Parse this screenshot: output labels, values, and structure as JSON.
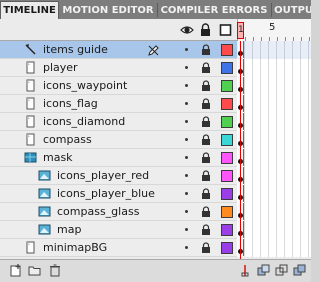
{
  "tabs": [
    {
      "label": "TIMELINE",
      "active": true
    },
    {
      "label": "MOTION EDITOR",
      "active": false
    },
    {
      "label": "COMPILER ERRORS",
      "active": false
    },
    {
      "label": "OUTPUT",
      "active": false
    }
  ],
  "header": {
    "icons": [
      "eye-icon",
      "lock-icon",
      "outline-icon"
    ],
    "ruler_numbers": [
      "1",
      "5"
    ],
    "playhead_frame": "1"
  },
  "layers": [
    {
      "name": "items guide",
      "type": "guide",
      "color": "#ff4b4b",
      "selected": true,
      "pencil": true
    },
    {
      "name": "player",
      "type": "normal",
      "color": "#3f73e8"
    },
    {
      "name": "icons_waypoint",
      "type": "normal",
      "color": "#4fd14f"
    },
    {
      "name": "icons_flag",
      "type": "normal",
      "color": "#ff4b4b"
    },
    {
      "name": "icons_diamond",
      "type": "normal",
      "color": "#4fd14f"
    },
    {
      "name": "compass",
      "type": "normal",
      "color": "#3bd6d6"
    },
    {
      "name": "mask",
      "type": "mask",
      "color": "#ff55ff"
    },
    {
      "name": "icons_player_red",
      "type": "masked",
      "color": "#ff55ff"
    },
    {
      "name": "icons_player_blue",
      "type": "masked",
      "color": "#9a3ee8"
    },
    {
      "name": "compass_glass",
      "type": "masked",
      "color": "#ff8a1e"
    },
    {
      "name": "map",
      "type": "masked",
      "color": "#9a3ee8"
    },
    {
      "name": "minimapBG",
      "type": "normal",
      "color": "#9a3ee8"
    }
  ],
  "footer": {
    "buttons": [
      "new-layer-icon",
      "new-folder-icon",
      "delete-layer-icon"
    ],
    "frame_buttons": [
      "center-frame-icon",
      "onion-skin-icon",
      "onion-outline-icon",
      "edit-multiple-icon"
    ]
  }
}
